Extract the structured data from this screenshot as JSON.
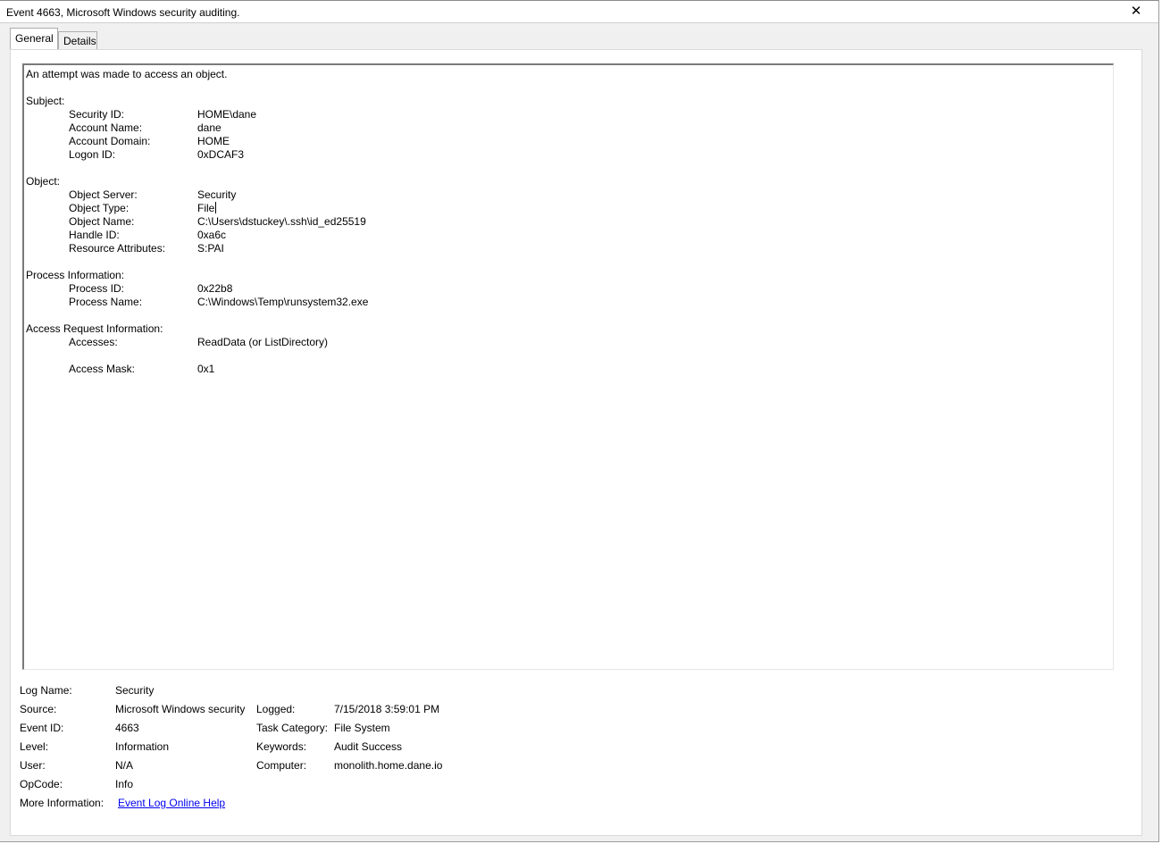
{
  "window": {
    "title": "Event 4663, Microsoft Windows security auditing.",
    "close_glyph": "✕"
  },
  "tabs": [
    {
      "label": "General",
      "active": true
    },
    {
      "label": "Details",
      "active": false
    }
  ],
  "description": {
    "intro": "An attempt was made to access an object.",
    "subject": {
      "heading": "Subject:",
      "fields": [
        {
          "key": "Security ID:",
          "value": "HOME\\dane"
        },
        {
          "key": "Account Name:",
          "value": "dane"
        },
        {
          "key": "Account Domain:",
          "value": "HOME"
        },
        {
          "key": "Logon ID:",
          "value": "0xDCAF3"
        }
      ]
    },
    "object": {
      "heading": "Object:",
      "fields": [
        {
          "key": "Object Server:",
          "value": "Security"
        },
        {
          "key": "Object Type:",
          "value": "File"
        },
        {
          "key": "Object Name:",
          "value": "C:\\Users\\dstuckey\\.ssh\\id_ed25519"
        },
        {
          "key": "Handle ID:",
          "value": "0xa6c"
        },
        {
          "key": "Resource Attributes:",
          "value": "S:PAI"
        }
      ]
    },
    "process": {
      "heading": "Process Information:",
      "fields": [
        {
          "key": "Process ID:",
          "value": "0x22b8"
        },
        {
          "key": "Process Name:",
          "value": "C:\\Windows\\Temp\\runsystem32.exe"
        }
      ]
    },
    "access": {
      "heading": "Access Request Information:",
      "fields": [
        {
          "key": "Accesses:",
          "value": "ReadData (or ListDirectory)"
        },
        {
          "key": "Access Mask:",
          "value": "0x1"
        }
      ]
    }
  },
  "meta": {
    "log_name": {
      "label": "Log Name:",
      "value": "Security"
    },
    "source": {
      "label": "Source:",
      "value": "Microsoft Windows security"
    },
    "event_id": {
      "label": "Event ID:",
      "value": "4663"
    },
    "level": {
      "label": "Level:",
      "value": "Information"
    },
    "user": {
      "label": "User:",
      "value": "N/A"
    },
    "opcode": {
      "label": "OpCode:",
      "value": "Info"
    },
    "more_info": {
      "label": "More Information:",
      "link": "Event Log Online Help"
    },
    "logged": {
      "label": "Logged:",
      "value": "7/15/2018 3:59:01 PM"
    },
    "task_category": {
      "label": "Task Category:",
      "value": "File System"
    },
    "keywords": {
      "label": "Keywords:",
      "value": "Audit Success"
    },
    "computer": {
      "label": "Computer:",
      "value": "monolith.home.dane.io"
    }
  }
}
